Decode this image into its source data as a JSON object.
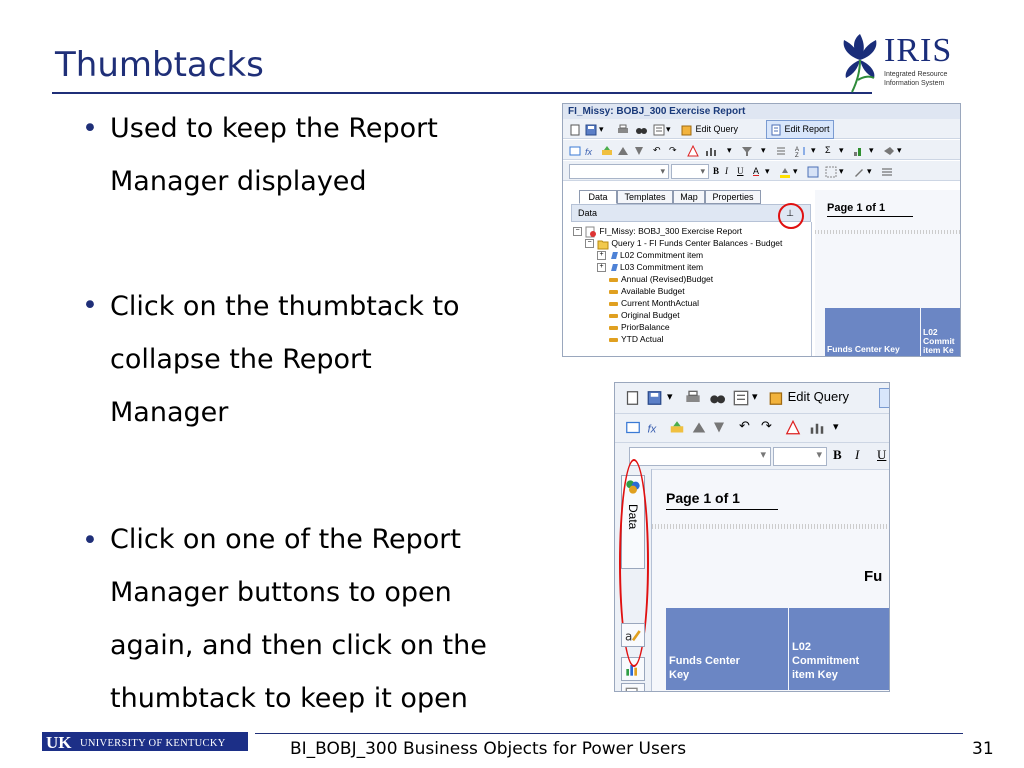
{
  "slide": {
    "title": "Thumbtacks",
    "bullets": [
      {
        "lines": [
          "Used to keep the Report",
          "Manager displayed"
        ]
      },
      {
        "lines": [
          "Click on the thumbtack to",
          "collapse the Report",
          "Manager"
        ]
      },
      {
        "lines": [
          "Click on one of the Report",
          "Manager buttons to open",
          "again, and then click on the",
          "thumbtack to keep it open"
        ]
      }
    ]
  },
  "logo": {
    "name": "IRIS",
    "line1": "Integrated Resource",
    "line2": "Information System"
  },
  "screenshot1": {
    "window_title": "FI_Missy: BOBJ_300 Exercise Report",
    "edit_query": "Edit Query",
    "edit_report": "Edit Report",
    "tabs": [
      "Data",
      "Templates",
      "Map",
      "Properties"
    ],
    "panel_header": "Data",
    "thumbtack_glyph": "⊥",
    "tree": [
      "FI_Missy: BOBJ_300 Exercise Report",
      "Query 1 - FI Funds Center Balances - Budget",
      "L02 Commitment item",
      "L03 Commitment item",
      "Annual (Revised)Budget",
      "Available  Budget",
      "Current MonthActual",
      "Original Budget",
      "PriorBalance",
      "YTD Actual"
    ],
    "page_label": "Page 1 of 1",
    "col1": "Funds Center Key",
    "col2_line1": "L02",
    "col2_line2": "Commit",
    "col2_line3": "item Ke"
  },
  "screenshot2": {
    "edit_query": "Edit Query",
    "side_tab": "Data",
    "page_label": "Page 1 of 1",
    "heading_fragment": "Fu",
    "col1_line1": "Funds Center",
    "col1_line2": "Key",
    "col2_line1": "L02",
    "col2_line2": "Commitment",
    "col2_line3": "item Key"
  },
  "footer": {
    "university": "UNIVERSITY OF KENTUCKY",
    "uk": "UK",
    "course": "BI_BOBJ_300 Business Objects for Power Users",
    "page_number": "31"
  },
  "colors": {
    "title": "#1f2f78",
    "accent_red": "#e01010",
    "header_blue": "#6b86c4",
    "uk_blue": "#1c2f87"
  }
}
